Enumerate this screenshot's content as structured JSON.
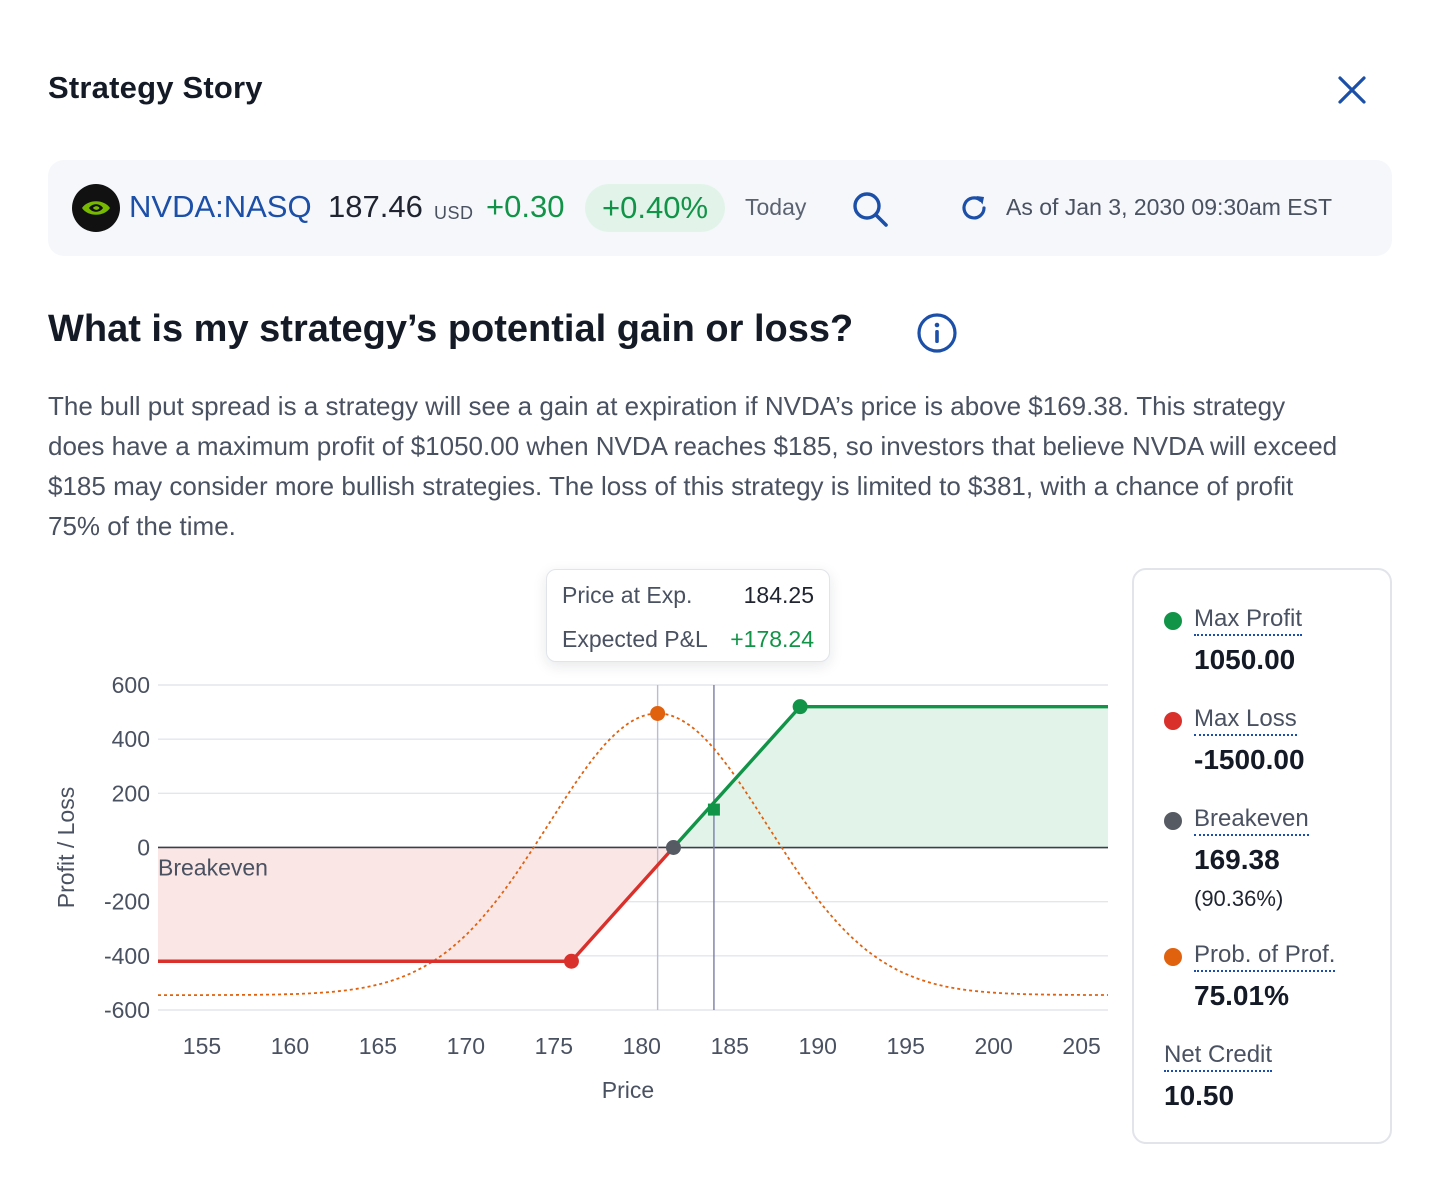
{
  "dialog": {
    "title": "Strategy Story"
  },
  "quote": {
    "ticker": "NVDA:NASQ",
    "price": "187.46",
    "currency": "USD",
    "change": "+0.30",
    "change_pct": "+0.40%",
    "period": "Today",
    "as_of": "As of Jan 3, 2030 09:30am EST"
  },
  "colors": {
    "profit": "#119448",
    "loss": "#d9302b",
    "breakeven": "#555a63",
    "probability": "#e0620f",
    "link": "#1c4fa8"
  },
  "section": {
    "question": "What is my strategy’s potential gain or loss?",
    "description": "The bull put spread is a strategy will see a gain at expiration if NVDA’s price is above $169.38. This strategy does have a maximum profit of $1050.00 when NVDA reaches $185, so investors that believe NVDA will exceed $185 may consider more bullish strategies. The loss of this strategy is limited to $381, with a chance of profit 75% of the time."
  },
  "tooltip": {
    "price_label": "Price at Exp.",
    "price_value": "184.25",
    "pl_label": "Expected P&L",
    "pl_value": "+178.24"
  },
  "stats": {
    "max_profit": {
      "label": "Max Profit",
      "value": "1050.00"
    },
    "max_loss": {
      "label": "Max Loss",
      "value": "-1500.00"
    },
    "breakeven": {
      "label": "Breakeven",
      "value": "169.38",
      "sub": "(90.36%)"
    },
    "prob_profit": {
      "label": "Prob. of Prof.",
      "value": "75.01%"
    },
    "net_credit": {
      "label": "Net Credit",
      "value": "10.50"
    }
  },
  "chart_data": {
    "type": "line",
    "xlabel": "Price",
    "ylabel": "Profit / Loss",
    "annotation": "Breakeven",
    "xlim": [
      152.5,
      206.5
    ],
    "ylim": [
      -600,
      600
    ],
    "x_ticks": [
      155,
      160,
      165,
      170,
      175,
      180,
      185,
      190,
      195,
      200,
      205
    ],
    "y_ticks": [
      600,
      400,
      200,
      0,
      -200,
      -400,
      -600
    ],
    "grid": true,
    "series": [
      {
        "values": [
          [
            152.5,
            -420
          ],
          [
            176,
            -420
          ],
          [
            181.8,
            0
          ],
          [
            189,
            520
          ],
          [
            206.5,
            520
          ]
        ]
      }
    ],
    "markers": [
      {
        "kind": "max-loss",
        "x": 176,
        "y": -420
      },
      {
        "kind": "breakeven",
        "x": 181.8,
        "y": 0
      },
      {
        "kind": "max-profit",
        "x": 189,
        "y": 520
      },
      {
        "kind": "prob-peak",
        "x": 180.9,
        "y": 495
      },
      {
        "kind": "cursor",
        "x": 184.1,
        "y": 140
      }
    ],
    "distribution": {
      "mean": 180.9,
      "sd": 6.2,
      "peak_y": 495,
      "base_y": -545
    },
    "vertical_lines": [
      180.9,
      184.1
    ]
  }
}
